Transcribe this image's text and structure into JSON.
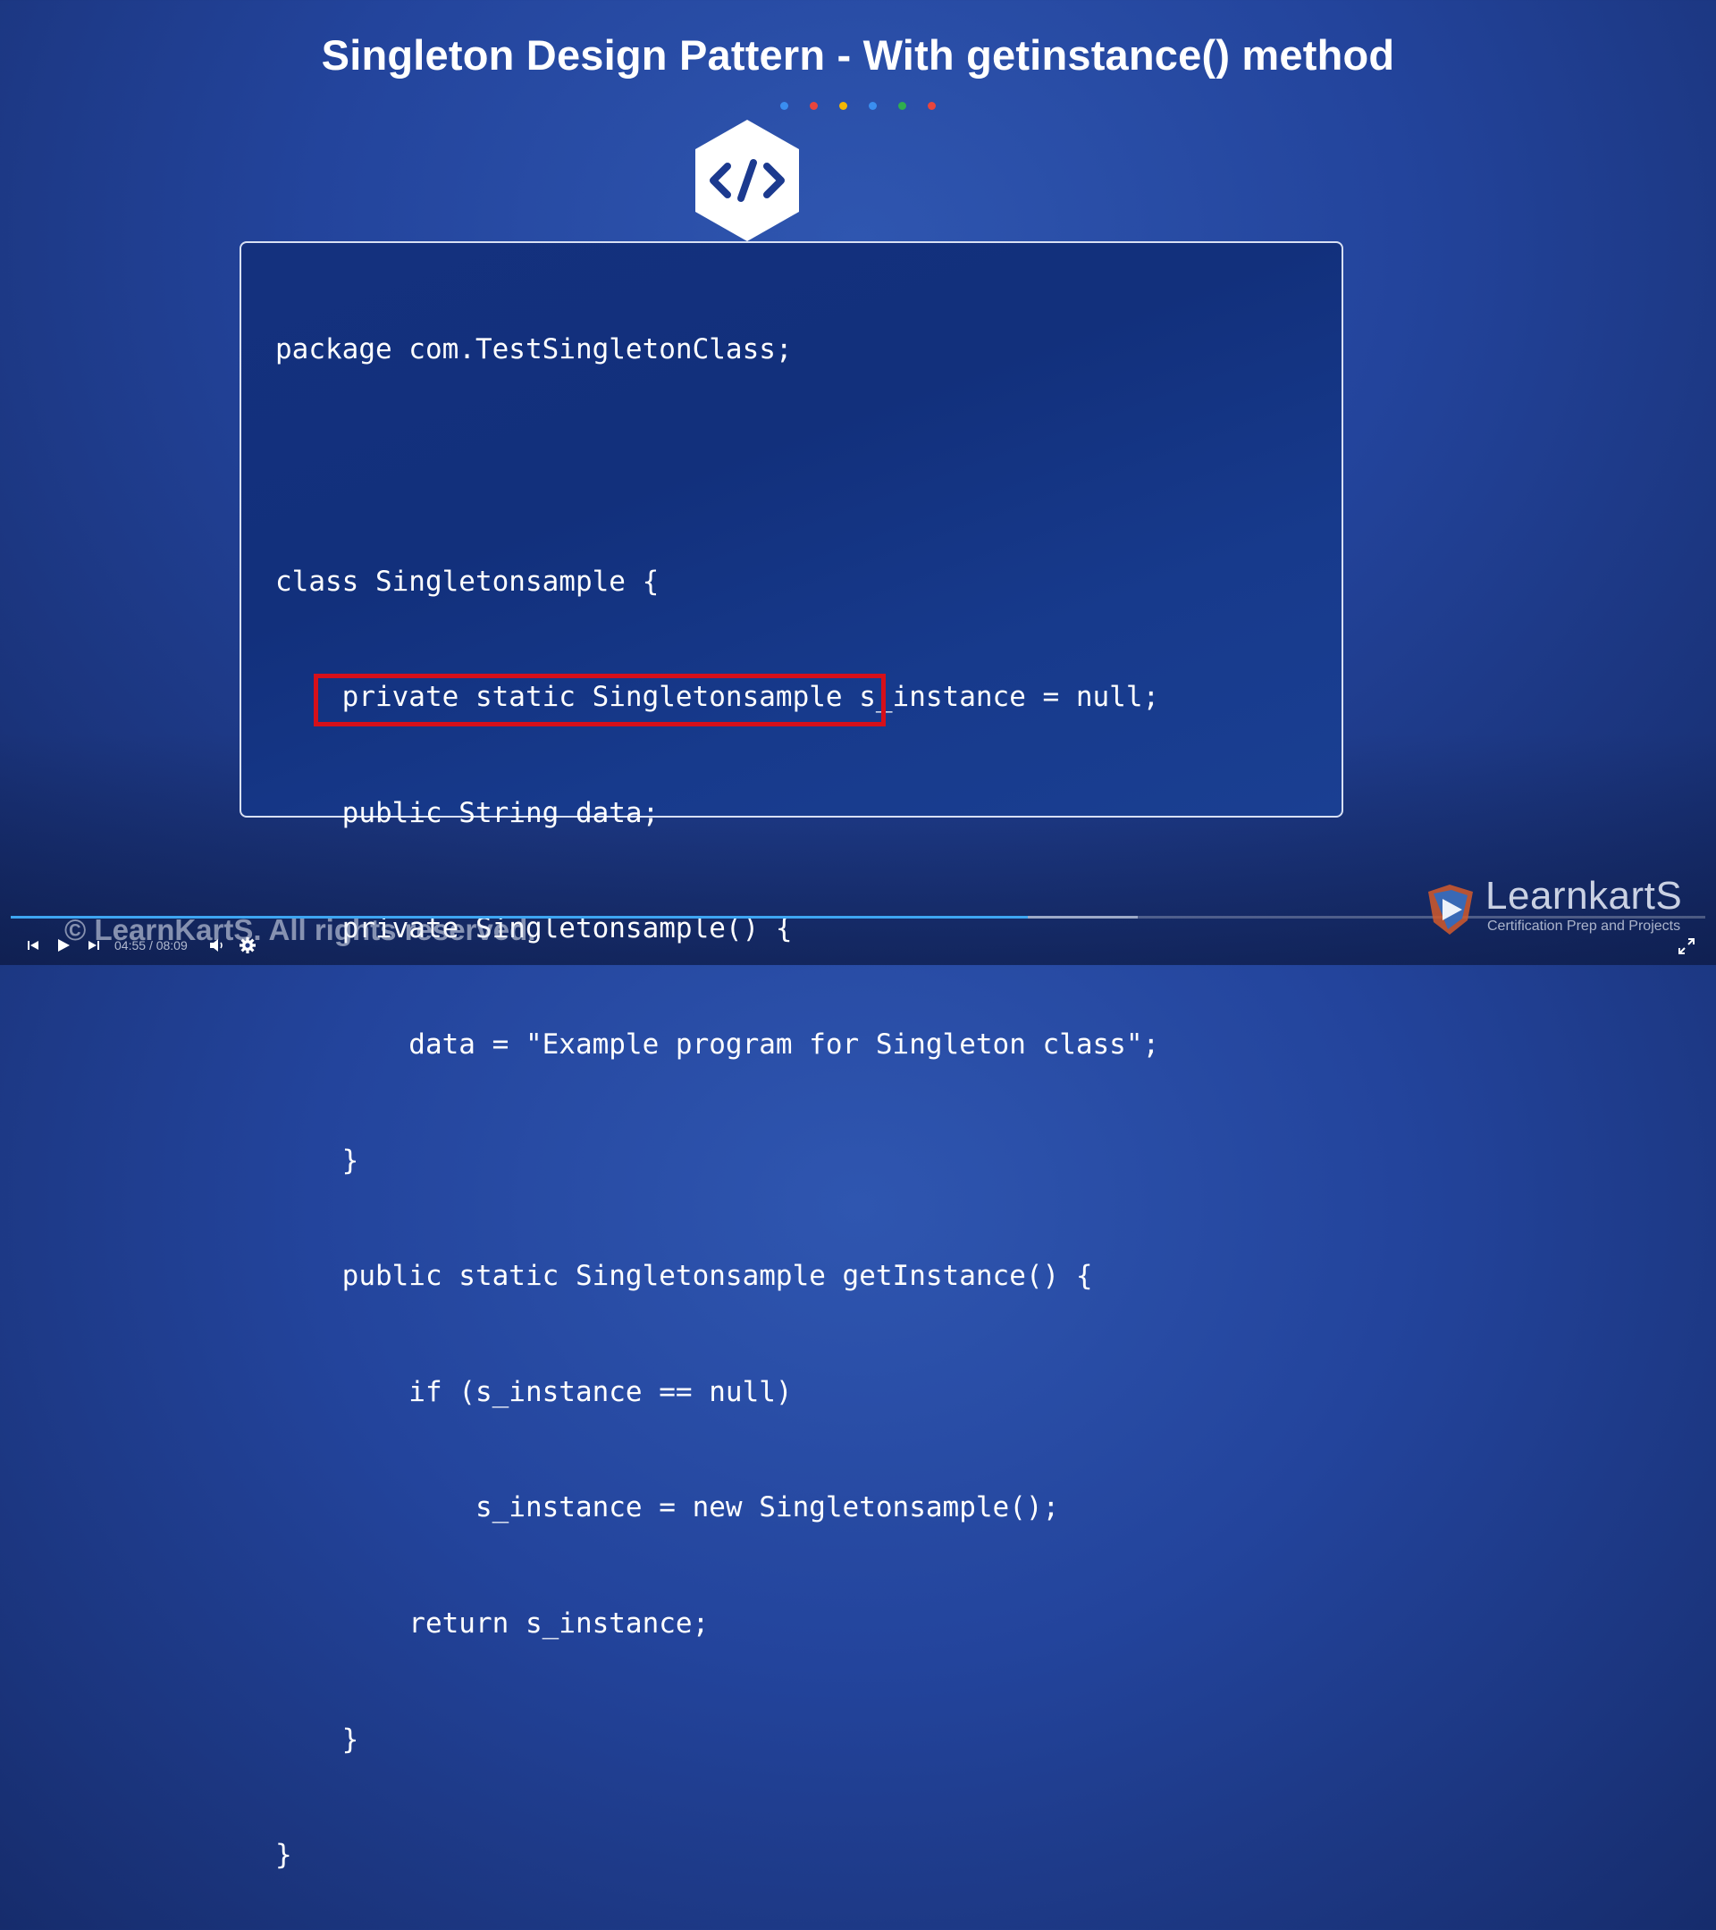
{
  "slide": {
    "title": "Singleton Design Pattern - With getinstance() method",
    "dots": [
      "#3a8ef0",
      "#e8453c",
      "#f2b705",
      "#3a8ef0",
      "#2fae4e",
      "#e8453c"
    ],
    "icon": "code-icon"
  },
  "code": {
    "lines": [
      "package com.TestSingletonClass;",
      "",
      "class Singletonsample {",
      "    private static Singletonsample s_instance = null;",
      "    public String data;",
      "    private Singletonsample() {",
      "        data = \"Example program for Singleton class\";",
      "    }",
      "    public static Singletonsample getInstance() {",
      "        if (s_instance == null)",
      "            s_instance = new Singletonsample();",
      "        return s_instance;",
      "    }",
      "}"
    ],
    "highlight_color": "#d6101a"
  },
  "player": {
    "current_time": "04:55",
    "separator": "/",
    "duration": "08:09",
    "progress": 0.6,
    "buffered": 0.665,
    "progress_color": "#3ea6f2",
    "copyright": "© LearnKartS. All rights reserved.",
    "controls": [
      "previous-icon",
      "play-icon",
      "next-icon",
      "volume-icon",
      "settings-icon",
      "fullscreen-icon"
    ]
  },
  "brand": {
    "name": "LearnkartS",
    "tagline": "Certification Prep and Projects"
  }
}
